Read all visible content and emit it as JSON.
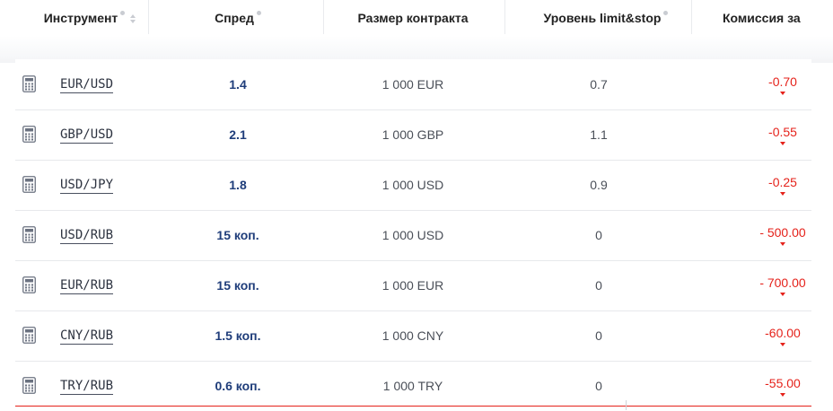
{
  "header": {
    "instrument": "Инструмент",
    "spread": "Спред",
    "contract_size": "Размер контракта",
    "limit_stop": "Уровень limit&stop",
    "commission": "Комиссия за"
  },
  "colors": {
    "accent_blue": "#1f3d7a",
    "negative_red": "#e5221b"
  },
  "rows": [
    {
      "instrument": "EUR/USD",
      "spread": "1.4",
      "contract": "1 000 EUR",
      "limit": "0.7",
      "commission": "-0.70"
    },
    {
      "instrument": "GBP/USD",
      "spread": "2.1",
      "contract": "1 000 GBP",
      "limit": "1.1",
      "commission": "-0.55"
    },
    {
      "instrument": "USD/JPY",
      "spread": "1.8",
      "contract": "1 000 USD",
      "limit": "0.9",
      "commission": "-0.25"
    },
    {
      "instrument": "USD/RUB",
      "spread": "15 коп.",
      "contract": "1 000 USD",
      "limit": "0",
      "commission": "- 500.00"
    },
    {
      "instrument": "EUR/RUB",
      "spread": "15 коп.",
      "contract": "1 000 EUR",
      "limit": "0",
      "commission": "- 700.00"
    },
    {
      "instrument": "CNY/RUB",
      "spread": "1.5 коп.",
      "contract": "1 000 CNY",
      "limit": "0",
      "commission": "-60.00"
    },
    {
      "instrument": "TRY/RUB",
      "spread": "0.6 коп.",
      "contract": "1 000 TRY",
      "limit": "0",
      "commission": "-55.00"
    }
  ]
}
